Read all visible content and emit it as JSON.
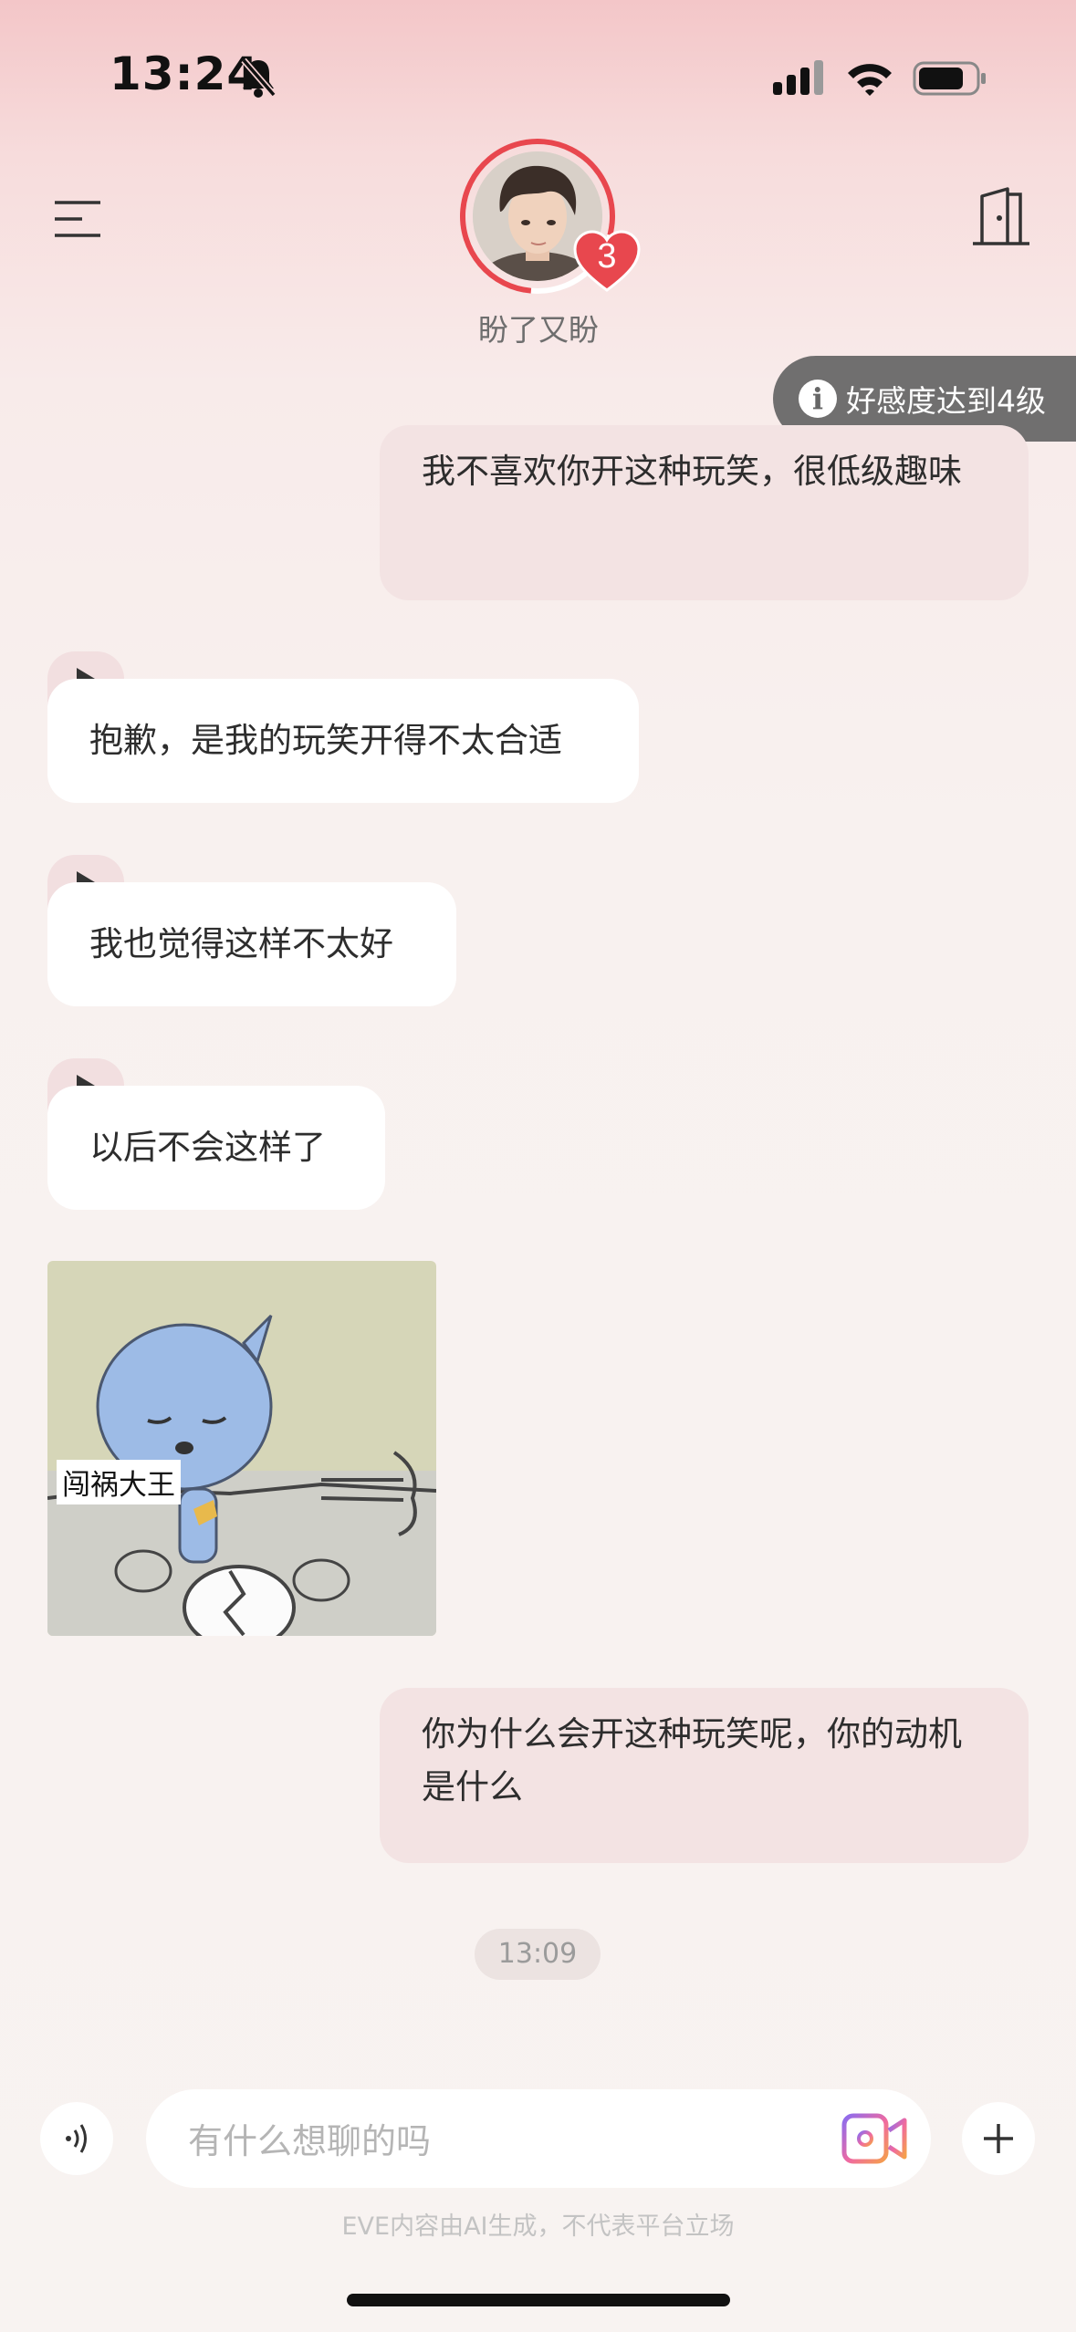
{
  "status_bar": {
    "time": "13:24",
    "bell": "bell-slash-icon",
    "signal": "cellular-signal-icon",
    "wifi": "wifi-icon",
    "battery": "battery-icon"
  },
  "header": {
    "menu_icon": "menu-icon",
    "door_icon": "exit-door-icon",
    "character_name": "盼了又盼",
    "heart_level": "3",
    "accent_color": "#e8474e"
  },
  "toast": {
    "icon": "info-icon",
    "text": "好感度达到4级"
  },
  "messages": [
    {
      "role": "user",
      "text": "我不喜欢你开这种玩笑，很低级趣味"
    },
    {
      "role": "ai",
      "text": "抱歉，是我的玩笑开得不太合适"
    },
    {
      "role": "ai",
      "text": "我也觉得这样不太好"
    },
    {
      "role": "ai",
      "text": "以后不会这样了"
    },
    {
      "role": "ai",
      "type": "sticker",
      "caption": "闯祸大王"
    },
    {
      "role": "user",
      "text": "你为什么会开这种玩笑呢，你的动机是什么"
    }
  ],
  "timestamp": "13:09",
  "input": {
    "placeholder": "有什么想聊的吗"
  },
  "disclaimer": "EVE内容由AI生成，不代表平台立场"
}
